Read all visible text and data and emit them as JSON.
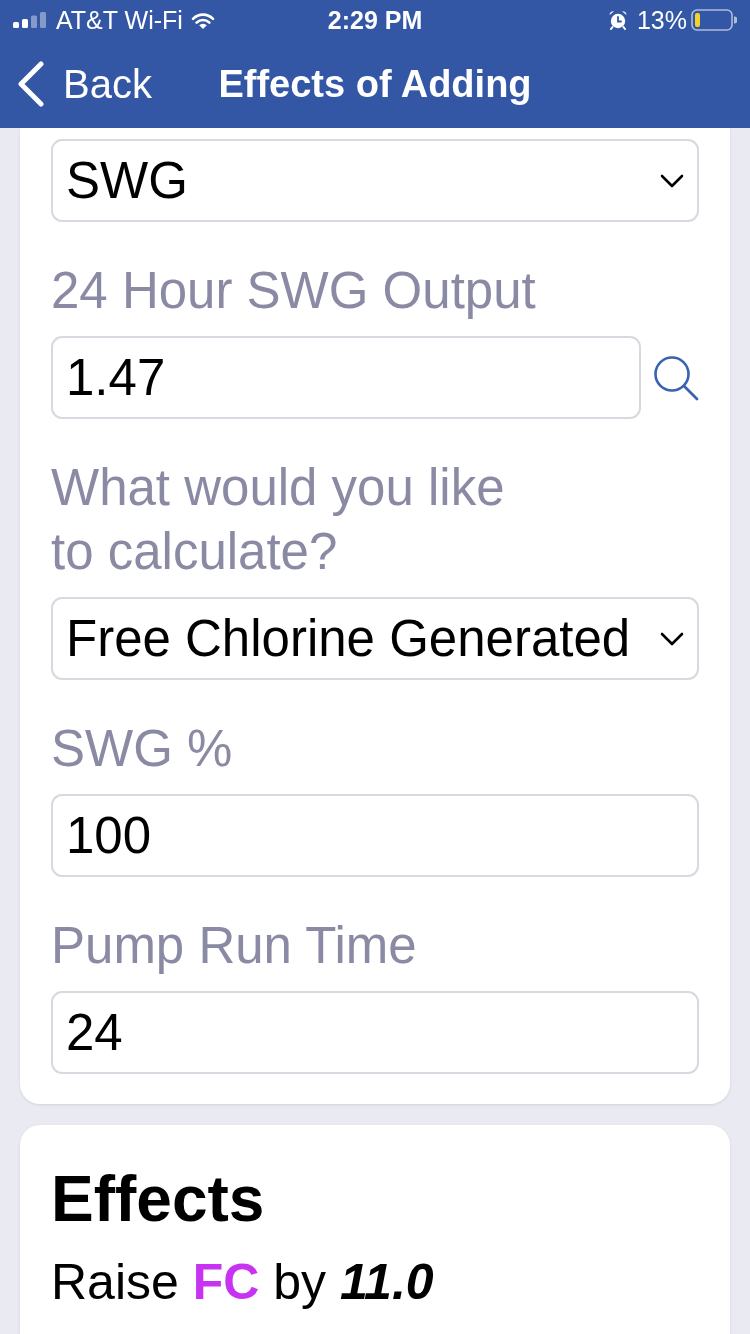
{
  "status_bar": {
    "carrier": "AT&T Wi-Fi",
    "time": "2:29 PM",
    "battery_percent": "13%"
  },
  "nav": {
    "back": "Back",
    "title": "Effects of Adding"
  },
  "fields": [
    {
      "kind": "select",
      "value": "SWG"
    },
    {
      "label": "24 Hour SWG Output",
      "kind": "input",
      "value": "1.47",
      "search_button": true
    },
    {
      "label": "What would you like to calculate?",
      "kind": "select",
      "value": "Free Chlorine Generated"
    },
    {
      "label": "SWG %",
      "kind": "input",
      "value": "100"
    },
    {
      "label": "Pump Run Time",
      "kind": "input",
      "value": "24"
    }
  ],
  "effects": {
    "title": "Effects",
    "items": [
      {
        "action": "Raise",
        "chemical": "FC",
        "color": "#c832f3",
        "connector": "by",
        "amount": "11.0"
      }
    ]
  }
}
